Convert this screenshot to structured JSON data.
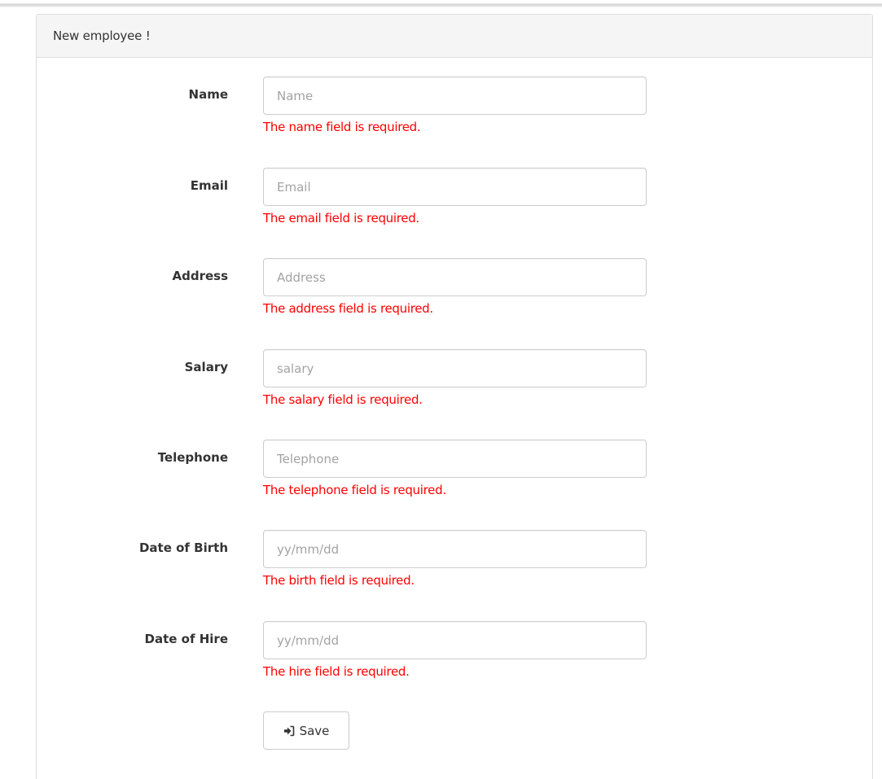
{
  "panel": {
    "title": "New employee !"
  },
  "fields": [
    {
      "label": "Name",
      "placeholder": "Name",
      "error": "The name field is required."
    },
    {
      "label": "Email",
      "placeholder": "Email",
      "error": "The email field is required."
    },
    {
      "label": "Address",
      "placeholder": "Address",
      "error": "The address field is required."
    },
    {
      "label": "Salary",
      "placeholder": "salary",
      "error": "The salary field is required."
    },
    {
      "label": "Telephone",
      "placeholder": "Telephone",
      "error": "The telephone field is required."
    },
    {
      "label": "Date of Birth",
      "placeholder": "yy/mm/dd",
      "error": "The birth field is required."
    },
    {
      "label": "Date of Hire",
      "placeholder": "yy/mm/dd",
      "error": "The hire field is required."
    }
  ],
  "actions": {
    "save_label": "Save",
    "save_icon": "sign-in-icon"
  },
  "colors": {
    "error": "#ff0000",
    "heading_bg": "#f5f5f5",
    "border": "#cccccc"
  }
}
